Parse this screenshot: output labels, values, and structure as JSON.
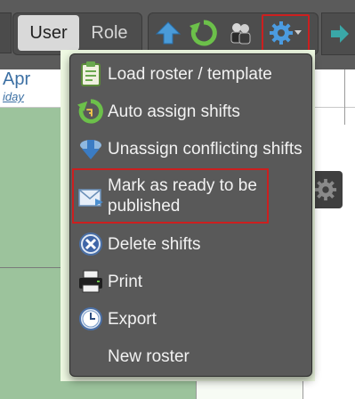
{
  "toolbar": {
    "user_label": "User",
    "role_label": "Role"
  },
  "calendar": {
    "month_label": "Apr",
    "day_label": "iday"
  },
  "menu": {
    "items": [
      {
        "label": "Load roster / template",
        "icon": "clipboard-icon"
      },
      {
        "label": "Auto assign shifts",
        "icon": "refresh-icon"
      },
      {
        "label": "Unassign conflicting shifts",
        "icon": "arrow-down-icon"
      },
      {
        "label_line1": "Mark as ready to be",
        "label_line2": "published",
        "icon": "envelope-icon"
      },
      {
        "label": "Delete shifts",
        "icon": "delete-icon"
      },
      {
        "label": "Print",
        "icon": "printer-icon"
      },
      {
        "label": "Export",
        "icon": "clock-icon"
      },
      {
        "label": "New roster",
        "icon": ""
      }
    ]
  },
  "colors": {
    "highlight": "#cc1f1f",
    "menu_bg": "#595959",
    "toolbar_bg": "#5b5b5b",
    "calendar_green": "#9cc39c",
    "link_blue": "#3b6fa3"
  }
}
